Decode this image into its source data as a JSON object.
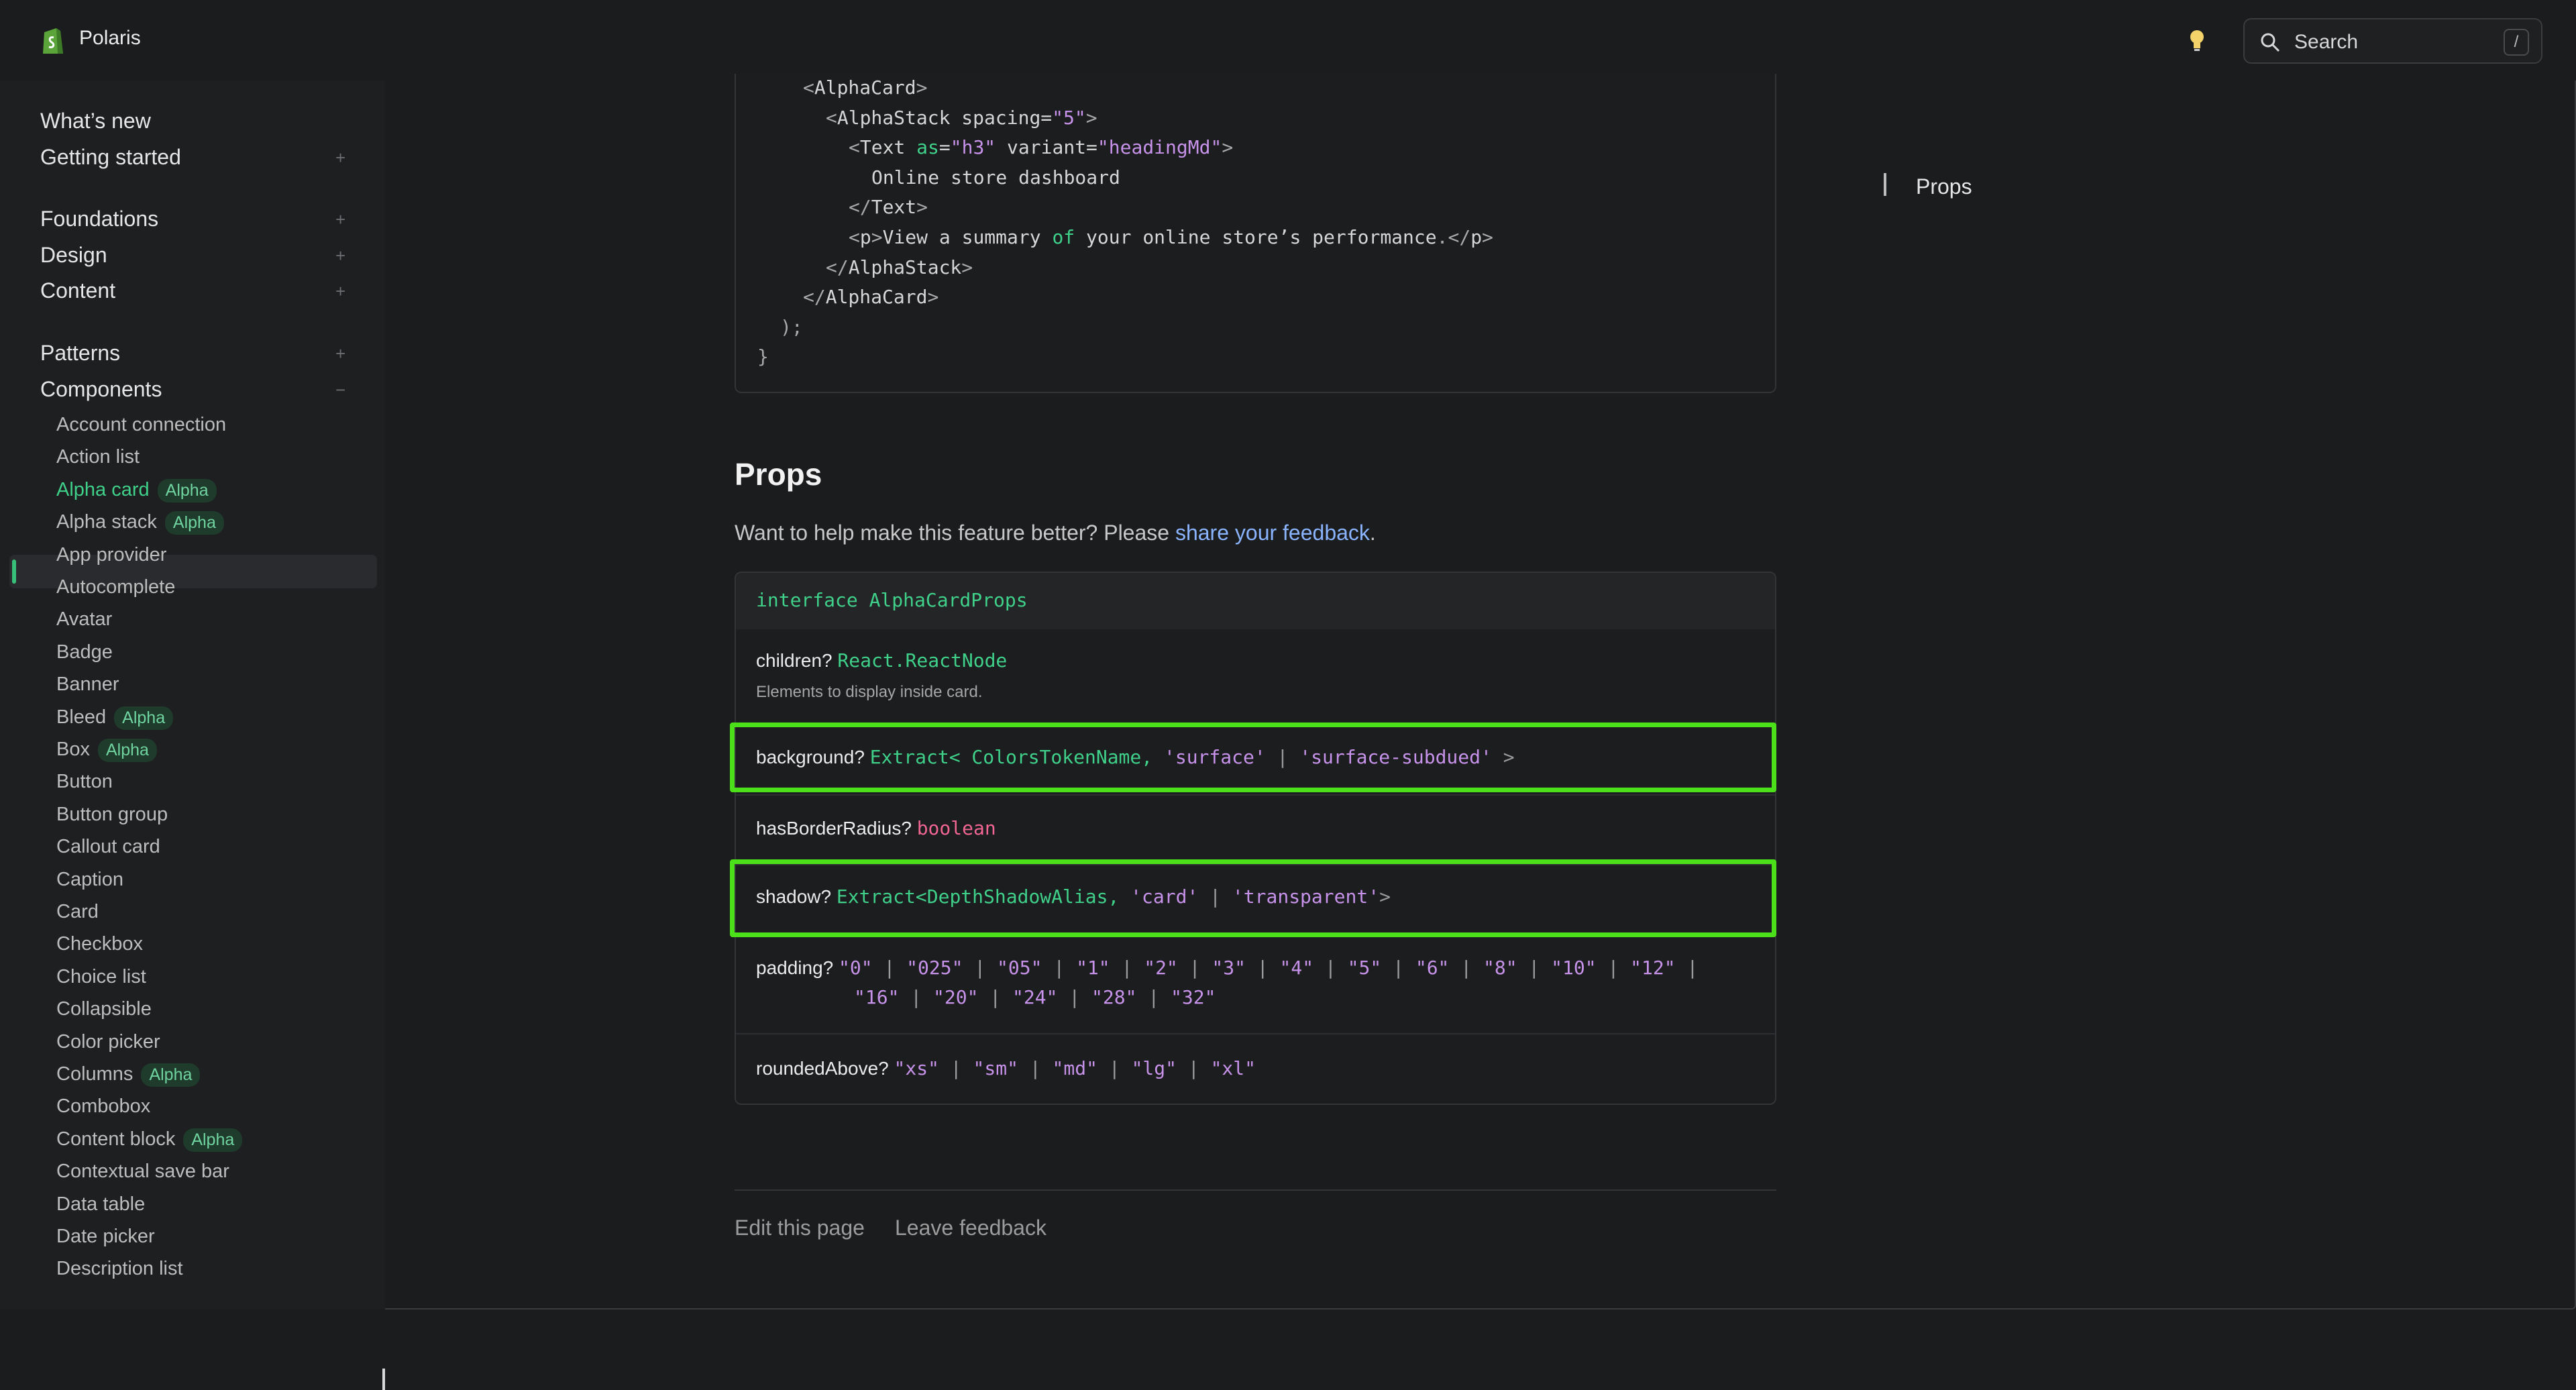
{
  "header": {
    "brand": "Polaris",
    "search_placeholder": "Search",
    "search_shortcut": "/"
  },
  "sidebar": {
    "top": [
      "What’s new",
      "Getting started"
    ],
    "section2": [
      "Foundations",
      "Design",
      "Content"
    ],
    "section3": [
      "Patterns",
      "Components"
    ],
    "expand_symbol": "+",
    "collapse_symbol": "−",
    "components": [
      {
        "label": "Account connection"
      },
      {
        "label": "Action list"
      },
      {
        "label": "Alpha card",
        "badge": "Alpha",
        "active": true
      },
      {
        "label": "Alpha stack",
        "badge": "Alpha"
      },
      {
        "label": "App provider"
      },
      {
        "label": "Autocomplete"
      },
      {
        "label": "Avatar"
      },
      {
        "label": "Badge"
      },
      {
        "label": "Banner"
      },
      {
        "label": "Bleed",
        "badge": "Alpha"
      },
      {
        "label": "Box",
        "badge": "Alpha"
      },
      {
        "label": "Button"
      },
      {
        "label": "Button group"
      },
      {
        "label": "Callout card"
      },
      {
        "label": "Caption"
      },
      {
        "label": "Card"
      },
      {
        "label": "Checkbox"
      },
      {
        "label": "Choice list"
      },
      {
        "label": "Collapsible"
      },
      {
        "label": "Color picker"
      },
      {
        "label": "Columns",
        "badge": "Alpha"
      },
      {
        "label": "Combobox"
      },
      {
        "label": "Content block",
        "badge": "Alpha"
      },
      {
        "label": "Contextual save bar"
      },
      {
        "label": "Data table"
      },
      {
        "label": "Date picker"
      },
      {
        "label": "Description list"
      }
    ]
  },
  "code": {
    "lines": [
      {
        "indent": 2,
        "tokens": [
          [
            "punc",
            "<"
          ],
          [
            "text",
            "AlphaCard"
          ],
          [
            "punc",
            ">"
          ]
        ]
      },
      {
        "indent": 3,
        "tokens": [
          [
            "punc",
            "<"
          ],
          [
            "text",
            "AlphaStack "
          ],
          [
            "text",
            "spacing="
          ],
          [
            "str",
            "\"5\""
          ],
          [
            "punc",
            ">"
          ]
        ]
      },
      {
        "indent": 4,
        "tokens": [
          [
            "punc",
            "<"
          ],
          [
            "text",
            "Text "
          ],
          [
            "attr",
            "as"
          ],
          [
            "text",
            "="
          ],
          [
            "str",
            "\"h3\""
          ],
          [
            "text",
            " variant="
          ],
          [
            "str",
            "\"headingMd\""
          ],
          [
            "punc",
            ">"
          ]
        ]
      },
      {
        "indent": 5,
        "tokens": [
          [
            "text",
            "Online store dashboard"
          ]
        ]
      },
      {
        "indent": 4,
        "tokens": [
          [
            "punc",
            "</"
          ],
          [
            "text",
            "Text"
          ],
          [
            "punc",
            ">"
          ]
        ]
      },
      {
        "indent": 4,
        "tokens": [
          [
            "punc",
            "<"
          ],
          [
            "text",
            "p"
          ],
          [
            "punc",
            ">"
          ],
          [
            "text",
            "View a summary "
          ],
          [
            "kw",
            "of"
          ],
          [
            "text",
            " your online store’s performance"
          ],
          [
            "punc",
            ".</"
          ],
          [
            "text",
            "p"
          ],
          [
            "punc",
            ">"
          ]
        ]
      },
      {
        "indent": 3,
        "tokens": [
          [
            "punc",
            "</"
          ],
          [
            "text",
            "AlphaStack"
          ],
          [
            "punc",
            ">"
          ]
        ]
      },
      {
        "indent": 2,
        "tokens": [
          [
            "punc",
            "</"
          ],
          [
            "text",
            "AlphaCard"
          ],
          [
            "punc",
            ">"
          ]
        ]
      },
      {
        "indent": 1,
        "tokens": [
          [
            "punc",
            ");"
          ]
        ]
      },
      {
        "indent": 0,
        "tokens": [
          [
            "punc",
            "}"
          ]
        ]
      }
    ]
  },
  "props": {
    "title": "Props",
    "desc_prefix": "Want to help make this feature better? Please ",
    "desc_link": "share your feedback",
    "desc_suffix": ".",
    "interface": "interface AlphaCardProps",
    "children_name": "children?",
    "children_type": "React.ReactNode",
    "children_desc": "Elements to display inside card.",
    "background_name": "background?",
    "background_type_a": "Extract<",
    "background_type_b": " ColorsTokenName,",
    "background_str_a": " 'surface'",
    "background_pipe": " |",
    "background_str_b": " 'surface-subdued'",
    "background_end": " >",
    "hasBorderRadius_name": "hasBorderRadius?",
    "hasBorderRadius_type": "boolean",
    "shadow_name": "shadow?",
    "shadow_type_a": "Extract<DepthShadowAlias,",
    "shadow_str_a": " 'card'",
    "shadow_pipe": " |",
    "shadow_str_b": " 'transparent'",
    "shadow_end": ">",
    "padding_name": "padding?",
    "padding_line1": [
      "\"0\"",
      "\"025\"",
      "\"05\"",
      "\"1\"",
      "\"2\"",
      "\"3\"",
      "\"4\"",
      "\"5\"",
      "\"6\"",
      "\"8\"",
      "\"10\"",
      "\"12\""
    ],
    "padding_line2": [
      "\"16\"",
      "\"20\"",
      "\"24\"",
      "\"28\"",
      "\"32\""
    ],
    "roundedAbove_name": "roundedAbove?",
    "roundedAbove_values": [
      "\"xs\"",
      "\"sm\"",
      "\"md\"",
      "\"lg\"",
      "\"xl\""
    ]
  },
  "footer": {
    "edit": "Edit this page",
    "feedback": "Leave feedback"
  },
  "toc": {
    "item": "Props"
  },
  "colors": {
    "accent_green": "#3fd08a",
    "highlight": "#4be01a",
    "link": "#8ab4ff",
    "string": "#c792ea",
    "boolean": "#f06591"
  }
}
